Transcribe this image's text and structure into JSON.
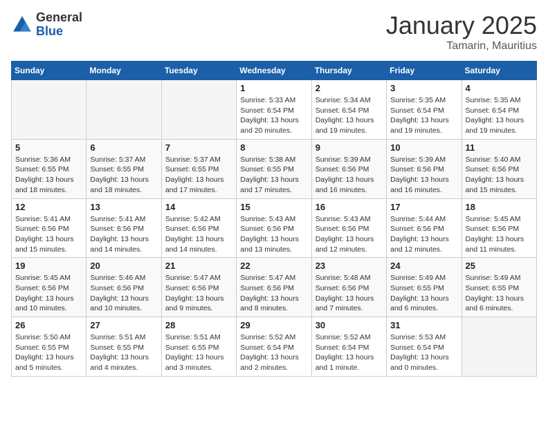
{
  "logo": {
    "general": "General",
    "blue": "Blue"
  },
  "title": "January 2025",
  "location": "Tamarin, Mauritius",
  "days_header": [
    "Sunday",
    "Monday",
    "Tuesday",
    "Wednesday",
    "Thursday",
    "Friday",
    "Saturday"
  ],
  "weeks": [
    [
      {
        "num": "",
        "info": ""
      },
      {
        "num": "",
        "info": ""
      },
      {
        "num": "",
        "info": ""
      },
      {
        "num": "1",
        "info": "Sunrise: 5:33 AM\nSunset: 6:54 PM\nDaylight: 13 hours\nand 20 minutes."
      },
      {
        "num": "2",
        "info": "Sunrise: 5:34 AM\nSunset: 6:54 PM\nDaylight: 13 hours\nand 19 minutes."
      },
      {
        "num": "3",
        "info": "Sunrise: 5:35 AM\nSunset: 6:54 PM\nDaylight: 13 hours\nand 19 minutes."
      },
      {
        "num": "4",
        "info": "Sunrise: 5:35 AM\nSunset: 6:54 PM\nDaylight: 13 hours\nand 19 minutes."
      }
    ],
    [
      {
        "num": "5",
        "info": "Sunrise: 5:36 AM\nSunset: 6:55 PM\nDaylight: 13 hours\nand 18 minutes."
      },
      {
        "num": "6",
        "info": "Sunrise: 5:37 AM\nSunset: 6:55 PM\nDaylight: 13 hours\nand 18 minutes."
      },
      {
        "num": "7",
        "info": "Sunrise: 5:37 AM\nSunset: 6:55 PM\nDaylight: 13 hours\nand 17 minutes."
      },
      {
        "num": "8",
        "info": "Sunrise: 5:38 AM\nSunset: 6:55 PM\nDaylight: 13 hours\nand 17 minutes."
      },
      {
        "num": "9",
        "info": "Sunrise: 5:39 AM\nSunset: 6:56 PM\nDaylight: 13 hours\nand 16 minutes."
      },
      {
        "num": "10",
        "info": "Sunrise: 5:39 AM\nSunset: 6:56 PM\nDaylight: 13 hours\nand 16 minutes."
      },
      {
        "num": "11",
        "info": "Sunrise: 5:40 AM\nSunset: 6:56 PM\nDaylight: 13 hours\nand 15 minutes."
      }
    ],
    [
      {
        "num": "12",
        "info": "Sunrise: 5:41 AM\nSunset: 6:56 PM\nDaylight: 13 hours\nand 15 minutes."
      },
      {
        "num": "13",
        "info": "Sunrise: 5:41 AM\nSunset: 6:56 PM\nDaylight: 13 hours\nand 14 minutes."
      },
      {
        "num": "14",
        "info": "Sunrise: 5:42 AM\nSunset: 6:56 PM\nDaylight: 13 hours\nand 14 minutes."
      },
      {
        "num": "15",
        "info": "Sunrise: 5:43 AM\nSunset: 6:56 PM\nDaylight: 13 hours\nand 13 minutes."
      },
      {
        "num": "16",
        "info": "Sunrise: 5:43 AM\nSunset: 6:56 PM\nDaylight: 13 hours\nand 12 minutes."
      },
      {
        "num": "17",
        "info": "Sunrise: 5:44 AM\nSunset: 6:56 PM\nDaylight: 13 hours\nand 12 minutes."
      },
      {
        "num": "18",
        "info": "Sunrise: 5:45 AM\nSunset: 6:56 PM\nDaylight: 13 hours\nand 11 minutes."
      }
    ],
    [
      {
        "num": "19",
        "info": "Sunrise: 5:45 AM\nSunset: 6:56 PM\nDaylight: 13 hours\nand 10 minutes."
      },
      {
        "num": "20",
        "info": "Sunrise: 5:46 AM\nSunset: 6:56 PM\nDaylight: 13 hours\nand 10 minutes."
      },
      {
        "num": "21",
        "info": "Sunrise: 5:47 AM\nSunset: 6:56 PM\nDaylight: 13 hours\nand 9 minutes."
      },
      {
        "num": "22",
        "info": "Sunrise: 5:47 AM\nSunset: 6:56 PM\nDaylight: 13 hours\nand 8 minutes."
      },
      {
        "num": "23",
        "info": "Sunrise: 5:48 AM\nSunset: 6:56 PM\nDaylight: 13 hours\nand 7 minutes."
      },
      {
        "num": "24",
        "info": "Sunrise: 5:49 AM\nSunset: 6:55 PM\nDaylight: 13 hours\nand 6 minutes."
      },
      {
        "num": "25",
        "info": "Sunrise: 5:49 AM\nSunset: 6:55 PM\nDaylight: 13 hours\nand 6 minutes."
      }
    ],
    [
      {
        "num": "26",
        "info": "Sunrise: 5:50 AM\nSunset: 6:55 PM\nDaylight: 13 hours\nand 5 minutes."
      },
      {
        "num": "27",
        "info": "Sunrise: 5:51 AM\nSunset: 6:55 PM\nDaylight: 13 hours\nand 4 minutes."
      },
      {
        "num": "28",
        "info": "Sunrise: 5:51 AM\nSunset: 6:55 PM\nDaylight: 13 hours\nand 3 minutes."
      },
      {
        "num": "29",
        "info": "Sunrise: 5:52 AM\nSunset: 6:54 PM\nDaylight: 13 hours\nand 2 minutes."
      },
      {
        "num": "30",
        "info": "Sunrise: 5:52 AM\nSunset: 6:54 PM\nDaylight: 13 hours\nand 1 minute."
      },
      {
        "num": "31",
        "info": "Sunrise: 5:53 AM\nSunset: 6:54 PM\nDaylight: 13 hours\nand 0 minutes."
      },
      {
        "num": "",
        "info": ""
      }
    ]
  ]
}
